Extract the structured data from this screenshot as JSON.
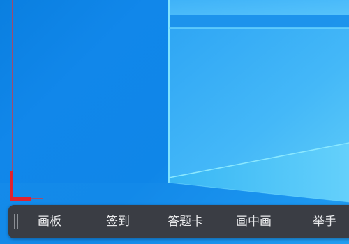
{
  "toolbar": {
    "items": [
      {
        "label": "画板"
      },
      {
        "label": "签到"
      },
      {
        "label": "答题卡"
      },
      {
        "label": "画中画"
      },
      {
        "label": "举手"
      }
    ]
  },
  "colors": {
    "wallpaper": "#0f86e8",
    "toolbar_background": "#3a3d44",
    "toolbar_text": "#e8e9eb",
    "selection_frame": "#e0222f"
  },
  "icons": {
    "toolbar_drag_handle": "grip-lines-vertical-icon",
    "selection_corner": "corner-bracket-icon"
  }
}
